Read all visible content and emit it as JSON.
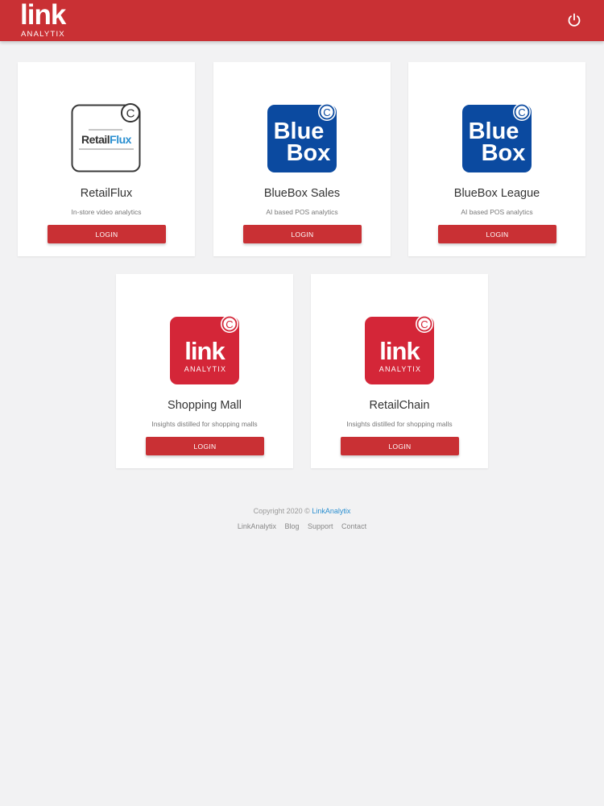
{
  "header": {
    "brand_main": "link",
    "brand_sub": "ANALYTIX",
    "power_icon": "power-icon"
  },
  "colors": {
    "brand_red": "#c93034",
    "bluebox_blue": "#0b4aa0",
    "link_red": "#d42638",
    "footer_link": "#2a8fd0"
  },
  "cards": [
    {
      "logo": "retailflux-logo",
      "logo_text_a": "Retail",
      "logo_text_b": "Flux",
      "title": "RetailFlux",
      "subtitle": "In-store video analytics",
      "button": "LOGIN"
    },
    {
      "logo": "bluebox-logo",
      "logo_text_a": "Blue",
      "logo_text_b": "Box",
      "title": "BlueBox Sales",
      "subtitle": "AI based POS analytics",
      "button": "LOGIN"
    },
    {
      "logo": "bluebox-logo",
      "logo_text_a": "Blue",
      "logo_text_b": "Box",
      "title": "BlueBox League",
      "subtitle": "AI based POS analytics",
      "button": "LOGIN"
    },
    {
      "logo": "link-analytix-logo",
      "logo_text_a": "link",
      "logo_text_b": "ANALYTIX",
      "title": "Shopping Mall",
      "subtitle": "Insights distilled for shopping malls",
      "button": "LOGIN"
    },
    {
      "logo": "link-analytix-logo",
      "logo_text_a": "link",
      "logo_text_b": "ANALYTIX",
      "title": "RetailChain",
      "subtitle": "Insights distilled for shopping malls",
      "button": "LOGIN"
    }
  ],
  "footer": {
    "copyright_prefix": "Copyright 2020 ©",
    "copyright_link": "LinkAnalytix",
    "links": [
      "LinkAnalytix",
      "Blog",
      "Support",
      "Contact"
    ]
  }
}
